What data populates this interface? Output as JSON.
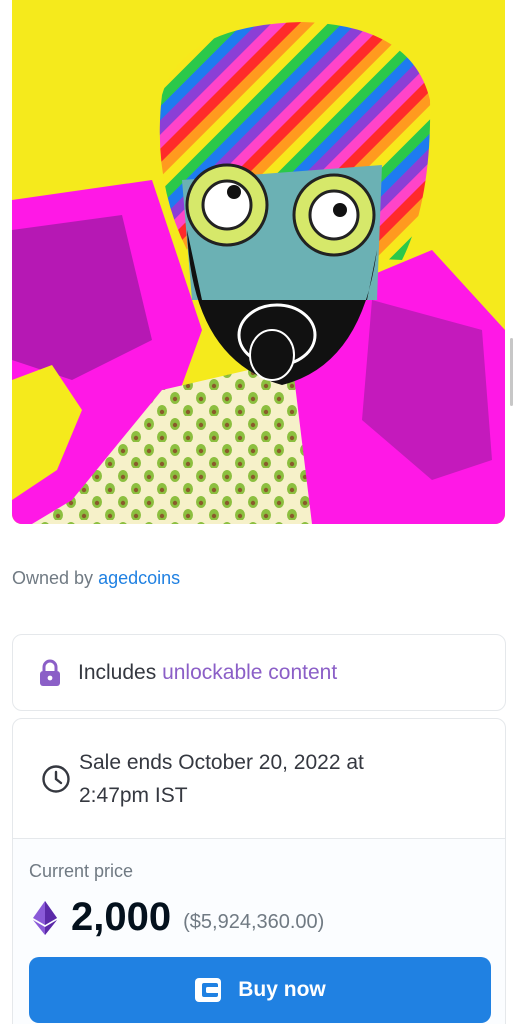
{
  "nft": {
    "image_label": "NFT artwork"
  },
  "ownership": {
    "prefix": "Owned by",
    "owner": "agedcoins"
  },
  "unlockable": {
    "prefix": "Includes",
    "link": "unlockable content",
    "icon": "lock-icon"
  },
  "sale": {
    "ends_text": "Sale ends October 20, 2022 at 2:47pm IST",
    "icon": "clock-icon"
  },
  "price": {
    "label": "Current price",
    "value": "2,000",
    "usd": "($5,924,360.00)",
    "currency_icon": "ethereum-icon"
  },
  "buy": {
    "label": "Buy now",
    "icon": "wallet-icon"
  },
  "colors": {
    "accent": "#2081e2",
    "unlockable": "#8b5fc7",
    "lock": "#8b5fc7"
  }
}
